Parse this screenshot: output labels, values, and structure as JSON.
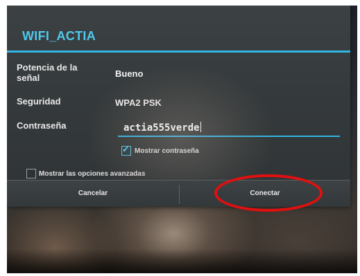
{
  "dialog": {
    "title": "WIFI_ACTIA",
    "rows": [
      {
        "label": "Potencia de la señal",
        "value": "Bueno"
      },
      {
        "label": "Seguridad",
        "value": "WPA2 PSK"
      },
      {
        "label": "Contraseña",
        "value": "actia555verde"
      }
    ],
    "show_password": {
      "label": "Mostrar contraseña",
      "checked": true
    },
    "advanced_options": {
      "label": "Mostrar las opciones avanzadas",
      "checked": false
    },
    "buttons": {
      "cancel": "Cancelar",
      "connect": "Conectar"
    }
  },
  "colors": {
    "accent": "#33b5e5",
    "annotation": "#e01010",
    "dialog_background": "#383d40"
  }
}
